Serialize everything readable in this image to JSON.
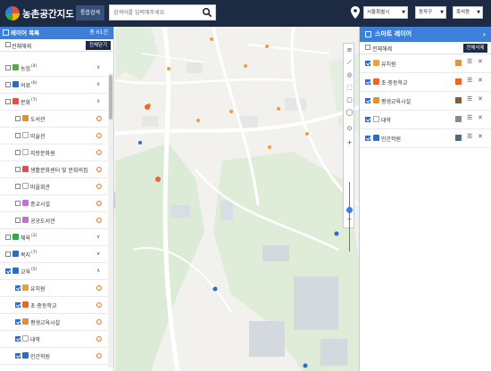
{
  "header": {
    "logo_text": "농촌공간지도",
    "combined_search_label": "통합검색",
    "search_placeholder": "검색어를 입력해주세요.",
    "region_province": "서울특별시",
    "region_district": "동작구",
    "region_dong": "흑석동"
  },
  "left_panel": {
    "title": "레이어 목록",
    "count": "총 61건",
    "select_all_label": "전체해제",
    "collapse_all_label": "전체닫기",
    "items": [
      {
        "label": "농업",
        "count": "(4)",
        "type": "group",
        "checked": false,
        "color": "#5aa852",
        "caret": "∨"
      },
      {
        "label": "의료",
        "count": "(6)",
        "type": "group",
        "checked": false,
        "color": "#2b6cc4",
        "caret": "∨"
      },
      {
        "label": "문화",
        "count": "(7)",
        "type": "group",
        "checked": false,
        "color": "#d9534f",
        "caret": "∧"
      },
      {
        "label": "도서관",
        "type": "sub",
        "checked": false,
        "color": "#e88e2f"
      },
      {
        "label": "미술관",
        "type": "sub",
        "checked": false,
        "color": "#ffffff"
      },
      {
        "label": "지방문화원",
        "type": "sub",
        "checked": false,
        "color": "#ffffff"
      },
      {
        "label": "생활문화센터 및 문화의집",
        "type": "sub",
        "checked": false,
        "color": "#d9534f"
      },
      {
        "label": "마을회관",
        "type": "sub",
        "checked": false,
        "color": "#ffffff"
      },
      {
        "label": "종교시설",
        "type": "sub",
        "checked": false,
        "color": "#c86bd9"
      },
      {
        "label": "공공도서관",
        "type": "sub",
        "checked": false,
        "color": "#c86bd9"
      },
      {
        "label": "체육",
        "count": "(2)",
        "type": "group",
        "checked": false,
        "color": "#2fa84f",
        "caret": "∨"
      },
      {
        "label": "복지",
        "count": "(7)",
        "type": "group",
        "checked": false,
        "color": "#2b6cc4",
        "caret": "∨"
      },
      {
        "label": "교육",
        "count": "(5)",
        "type": "group",
        "checked": true,
        "color": "#2b6cc4",
        "caret": "∧"
      },
      {
        "label": "유치원",
        "type": "sub",
        "checked": true,
        "color": "#f0a030"
      },
      {
        "label": "초·중등학교",
        "type": "sub",
        "checked": true,
        "color": "#e9662c"
      },
      {
        "label": "평생교육시설",
        "type": "sub",
        "checked": true,
        "color": "#e88e2f"
      },
      {
        "label": "대학",
        "type": "sub",
        "checked": true,
        "color": "#ffffff"
      },
      {
        "label": "민간학원",
        "type": "sub",
        "checked": true,
        "color": "#2b6cc4"
      }
    ]
  },
  "right_panel": {
    "title": "스마트 레이어",
    "select_all_label": "전체해제",
    "delete_all_label": "전체삭제",
    "items": [
      {
        "label": "유치원",
        "icon_color": "#f0a030",
        "swatch": "#e99632"
      },
      {
        "label": "초·중등학교",
        "icon_color": "#e9662c",
        "swatch": "#e9662c"
      },
      {
        "label": "평생교육시설",
        "icon_color": "#e88e2f",
        "swatch": "#8a5a32"
      },
      {
        "label": "대학",
        "icon_color": "#ffffff",
        "swatch": "#8a8a8a"
      },
      {
        "label": "민간학원",
        "icon_color": "#2b6cc4",
        "swatch": "#4a6d8c"
      }
    ]
  },
  "map_tools": {
    "items": [
      "layers-icon",
      "ruler-icon",
      "locate-icon",
      "area-icon",
      "clear-icon",
      "comment-icon",
      "target-icon",
      "zoom-in-icon",
      "zoom-out-icon"
    ]
  },
  "colors": {
    "top_bar": "#1d2a44",
    "panel_header": "#3d7fd9",
    "accent_orange": "#e07a1f"
  }
}
